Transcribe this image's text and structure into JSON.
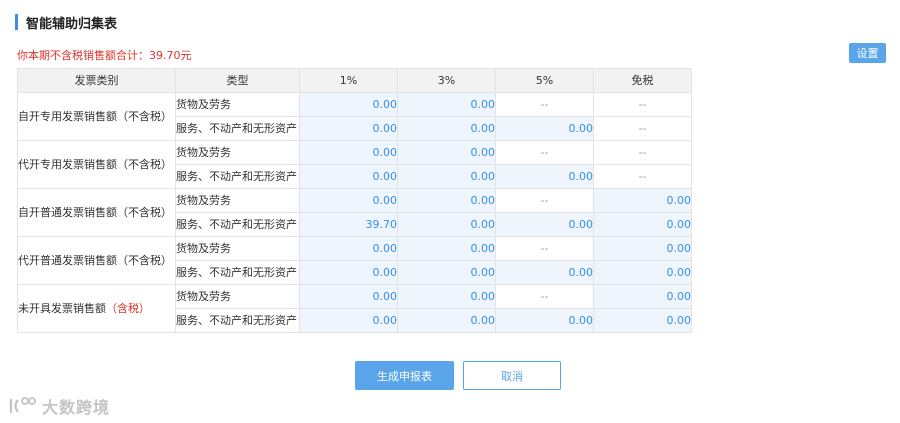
{
  "page": {
    "title": "智能辅助归集表",
    "summary": "你本期不含税销售额合计：39.70元",
    "settings_label": "设置"
  },
  "table": {
    "headers": [
      "发票类别",
      "类型",
      "1%",
      "3%",
      "5%",
      "免税"
    ],
    "groups": [
      {
        "category": "自开专用发票销售额（不含税）",
        "category_suffix": "",
        "rows": [
          {
            "type": "货物及劳务",
            "cells": [
              "0.00",
              "0.00",
              "--",
              "--"
            ]
          },
          {
            "type": "服务、不动产和无形资产",
            "cells": [
              "0.00",
              "0.00",
              "0.00",
              "--"
            ]
          }
        ]
      },
      {
        "category": "代开专用发票销售额（不含税）",
        "category_suffix": "",
        "rows": [
          {
            "type": "货物及劳务",
            "cells": [
              "0.00",
              "0.00",
              "--",
              "--"
            ]
          },
          {
            "type": "服务、不动产和无形资产",
            "cells": [
              "0.00",
              "0.00",
              "0.00",
              "--"
            ]
          }
        ]
      },
      {
        "category": "自开普通发票销售额（不含税）",
        "category_suffix": "",
        "rows": [
          {
            "type": "货物及劳务",
            "cells": [
              "0.00",
              "0.00",
              "--",
              "0.00"
            ]
          },
          {
            "type": "服务、不动产和无形资产",
            "cells": [
              "39.70",
              "0.00",
              "0.00",
              "0.00"
            ]
          }
        ]
      },
      {
        "category": "代开普通发票销售额（不含税）",
        "category_suffix": "",
        "rows": [
          {
            "type": "货物及劳务",
            "cells": [
              "0.00",
              "0.00",
              "--",
              "0.00"
            ]
          },
          {
            "type": "服务、不动产和无形资产",
            "cells": [
              "0.00",
              "0.00",
              "0.00",
              "0.00"
            ]
          }
        ]
      },
      {
        "category": "未开具发票销售额",
        "category_suffix": "（含税）",
        "rows": [
          {
            "type": "货物及劳务",
            "cells": [
              "0.00",
              "0.00",
              "--",
              "0.00"
            ]
          },
          {
            "type": "服务、不动产和无形资产",
            "cells": [
              "0.00",
              "0.00",
              "0.00",
              "0.00"
            ]
          }
        ]
      }
    ]
  },
  "actions": {
    "generate_label": "生成申报表",
    "cancel_label": "取消"
  },
  "watermark": {
    "text": "大数跨境",
    "icon": "logo-icon"
  },
  "colors": {
    "accent": "#3a8ee6",
    "button": "#5aa4ea",
    "warning_text": "#e0332d",
    "input_cell_bg": "#eef5fd"
  }
}
